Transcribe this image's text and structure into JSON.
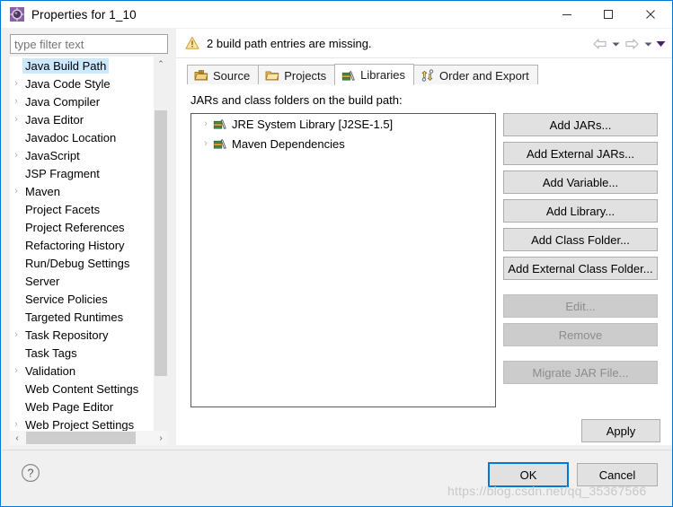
{
  "window": {
    "title": "Properties for 1_10",
    "app_icon": "eclipse-properties-icon",
    "controls": {
      "minimize": "—",
      "maximize": "☐",
      "close": "✕"
    },
    "accent_color": "#0078d7"
  },
  "filter": {
    "placeholder": "type filter text",
    "value": ""
  },
  "sidebar": {
    "selected": "Java Build Path",
    "items": [
      {
        "label": "Java Build Path",
        "expandable": false,
        "selected": true
      },
      {
        "label": "Java Code Style",
        "expandable": true,
        "selected": false
      },
      {
        "label": "Java Compiler",
        "expandable": true,
        "selected": false
      },
      {
        "label": "Java Editor",
        "expandable": true,
        "selected": false
      },
      {
        "label": "Javadoc Location",
        "expandable": false,
        "selected": false
      },
      {
        "label": "JavaScript",
        "expandable": true,
        "selected": false
      },
      {
        "label": "JSP Fragment",
        "expandable": false,
        "selected": false
      },
      {
        "label": "Maven",
        "expandable": true,
        "selected": false
      },
      {
        "label": "Project Facets",
        "expandable": false,
        "selected": false
      },
      {
        "label": "Project References",
        "expandable": false,
        "selected": false
      },
      {
        "label": "Refactoring History",
        "expandable": false,
        "selected": false
      },
      {
        "label": "Run/Debug Settings",
        "expandable": false,
        "selected": false
      },
      {
        "label": "Server",
        "expandable": false,
        "selected": false
      },
      {
        "label": "Service Policies",
        "expandable": false,
        "selected": false
      },
      {
        "label": "Targeted Runtimes",
        "expandable": false,
        "selected": false
      },
      {
        "label": "Task Repository",
        "expandable": true,
        "selected": false
      },
      {
        "label": "Task Tags",
        "expandable": false,
        "selected": false
      },
      {
        "label": "Validation",
        "expandable": true,
        "selected": false
      },
      {
        "label": "Web Content Settings",
        "expandable": false,
        "selected": false
      },
      {
        "label": "Web Page Editor",
        "expandable": false,
        "selected": false
      },
      {
        "label": "Web Project Settings",
        "expandable": true,
        "selected": false
      }
    ],
    "scrollbar": {
      "up_arrow": "⌃",
      "down_arrow": "⌄",
      "left_arrow": "‹",
      "right_arrow": "›"
    }
  },
  "banner": {
    "icon": "warning-icon",
    "message": "2 build path entries are missing.",
    "nav": {
      "back": "back-arrow-icon",
      "back_menu": "chevron-down-icon",
      "forward": "forward-arrow-icon",
      "forward_menu": "chevron-down-icon",
      "view_menu": "view-menu-arrow-icon"
    }
  },
  "tabs": [
    {
      "label": "Source",
      "icon": "source-folder-icon",
      "active": false
    },
    {
      "label": "Projects",
      "icon": "projects-folder-icon",
      "active": false
    },
    {
      "label": "Libraries",
      "icon": "libraries-books-icon",
      "active": true
    },
    {
      "label": "Order and Export",
      "icon": "order-export-icon",
      "active": false
    }
  ],
  "libraries_tab": {
    "caption": "JARs and class folders on the build path:",
    "entries": [
      {
        "label": "JRE System Library [J2SE-1.5]",
        "icon": "library-icon",
        "expandable": true
      },
      {
        "label": "Maven Dependencies",
        "icon": "library-icon",
        "expandable": true
      }
    ],
    "buttons": [
      {
        "label": "Add JARs...",
        "enabled": true
      },
      {
        "label": "Add External JARs...",
        "enabled": true
      },
      {
        "label": "Add Variable...",
        "enabled": true
      },
      {
        "label": "Add Library...",
        "enabled": true
      },
      {
        "label": "Add Class Folder...",
        "enabled": true
      },
      {
        "label": "Add External Class Folder...",
        "enabled": true
      },
      {
        "label": "Edit...",
        "enabled": false
      },
      {
        "label": "Remove",
        "enabled": false
      },
      {
        "label": "Migrate JAR File...",
        "enabled": false
      }
    ]
  },
  "footer": {
    "help": "help-icon",
    "apply": "Apply",
    "ok": "OK",
    "cancel": "Cancel"
  },
  "watermark": "https://blog.csdn.net/qq_35367566"
}
